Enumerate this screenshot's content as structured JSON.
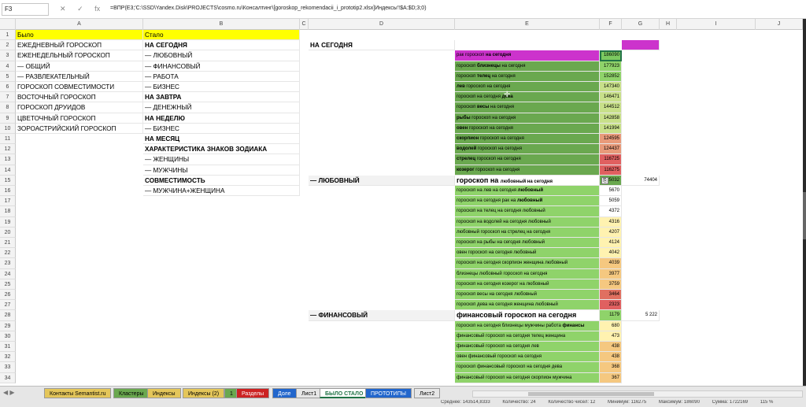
{
  "formula_bar": {
    "name_box": "F3",
    "fx": "fx",
    "formula": "=ВПР(E3;'C:\\SSD\\Yandex.Disk\\PROJECTS\\cosmo.ru\\Консалтинг\\[goroskop_rekomendacii_i_prototip2.xlsx]Индексы'!$A:$D;3;0)"
  },
  "columns": [
    "A",
    "B",
    "C",
    "D",
    "E",
    "F",
    "G",
    "H",
    "I",
    "J"
  ],
  "rows": [
    "1",
    "2",
    "3",
    "4",
    "5",
    "6",
    "7",
    "8",
    "9",
    "10",
    "11",
    "12",
    "13",
    "14",
    "15",
    "16",
    "17",
    "18",
    "19",
    "20",
    "21",
    "22",
    "23",
    "24",
    "25",
    "26",
    "27",
    "28",
    "29",
    "30",
    "31",
    "32",
    "33",
    "34"
  ],
  "col_a": [
    "Было",
    "ЕЖЕДНЕВНЫЙ ГОРОСКОП",
    "ЕЖЕНЕДЕЛЬНЫЙ ГОРОСКОП",
    "— ОБЩИЙ",
    "— РАЗВЛЕКАТЕЛЬНЫЙ",
    "ГОРОСКОП СОВМЕСТИМОСТИ",
    "ВОСТОЧНЫЙ ГОРОСКОП",
    "ГОРОСКОП ДРУИДОВ",
    "ЦВЕТОЧНЫЙ ГОРОСКОП",
    "ЗОРОАСТРИЙСКИЙ ГОРОСКОП"
  ],
  "col_b": [
    "Стало",
    "НА СЕГОДНЯ",
    "— ЛЮБОВНЫЙ",
    "— ФИНАНСОВЫЙ",
    "— РАБОТА",
    "— БИЗНЕС",
    "НА ЗАВТРА",
    "— ДЕНЕЖНЫЙ",
    "НА НЕДЕЛЮ",
    "— БИЗНЕС",
    "НА МЕСЯЦ",
    "ХАРАКТЕРИСТИКА ЗНАКОВ ЗОДИАКА",
    "— ЖЕНЩИНЫ",
    "— МУЖЧИНЫ",
    "СОВМЕСТИМОСТЬ",
    "— МУЖЧИНА+ЖЕНЩИНА"
  ],
  "col_d": {
    "r2": "НА СЕГОДНЯ",
    "r15": "— ЛЮБОВНЫЙ",
    "r28": "— ФИНАНСОВЫЙ"
  },
  "col_e": [
    {
      "pre": "рак гороскоп ",
      "bold": "на сегодня",
      "post": ""
    },
    {
      "pre": "гороскоп ",
      "bold": "близнецы",
      "post": " на сегодня"
    },
    {
      "pre": "гороскоп ",
      "bold": "телец",
      "post": " на сегодня"
    },
    {
      "pre": "",
      "bold": "лев",
      "post": " гороскоп на сегодня"
    },
    {
      "pre": "гороскоп на сегодня ",
      "bold": "дева",
      "post": ""
    },
    {
      "pre": "гороскоп ",
      "bold": "весы",
      "post": " на сегодня"
    },
    {
      "pre": "",
      "bold": "рыбы",
      "post": " гороскоп на сегодня"
    },
    {
      "pre": "",
      "bold": "овен",
      "post": " гороскоп на сегодня"
    },
    {
      "pre": "",
      "bold": "скорпион",
      "post": " гороскоп на сегодня"
    },
    {
      "pre": "",
      "bold": "водолей",
      "post": " гороскоп на сегодня"
    },
    {
      "pre": "",
      "bold": "стрелец",
      "post": " гороскоп на сегодня"
    },
    {
      "pre": "",
      "bold": "козерог",
      "post": " гороскоп на сегодня"
    },
    {
      "pre": "гороскоп на ",
      "bold": "любовный",
      "post": " на сегодня",
      "big": "гороскоп на "
    },
    {
      "pre": "гороскоп на лев на сегодня ",
      "bold": "любовный",
      "post": ""
    },
    {
      "pre": "гороскоп на сегодня рак на ",
      "bold": "любовный",
      "post": ""
    },
    {
      "pre": "гороскоп на телец на сегодня любовный",
      "bold": "",
      "post": ""
    },
    {
      "pre": "гороскоп на водолей на сегодня любовный",
      "bold": "",
      "post": ""
    },
    {
      "pre": "любовный гороскоп на стрелец на сегодня",
      "bold": "",
      "post": ""
    },
    {
      "pre": "гороскоп на рыбы на сегодня любовный",
      "bold": "",
      "post": ""
    },
    {
      "pre": "овен гороскоп на сегодня любовный",
      "bold": "",
      "post": ""
    },
    {
      "pre": "гороскоп на сегодня скорпион женщина любовный",
      "bold": "",
      "post": ""
    },
    {
      "pre": "близнецы любовный гороскоп на сегодня",
      "bold": "",
      "post": ""
    },
    {
      "pre": "гороскоп на сегодня козерог на любовный",
      "bold": "",
      "post": ""
    },
    {
      "pre": "гороскоп весы на сегодня любовный",
      "bold": "",
      "post": ""
    },
    {
      "pre": "гороскоп дева на сегодня женщина любовный",
      "bold": "",
      "post": ""
    },
    {
      "pre": "финансовый гороскоп на сегодня",
      "bold": "",
      "post": "",
      "big": "финансовый гороскоп на сегодня"
    },
    {
      "pre": "гороскоп на сегодня близнецы мужчины работа ",
      "bold": "финансы",
      "post": ""
    },
    {
      "pre": "финансовый гороскоп на сегодня телец женщина",
      "bold": "",
      "post": ""
    },
    {
      "pre": "финансовый гороскоп на сегодня лев",
      "bold": "",
      "post": ""
    },
    {
      "pre": "овен финансовый гороскоп на сегодня",
      "bold": "",
      "post": ""
    },
    {
      "pre": "гороскоп финансовый гороскоп на сегодня дева",
      "bold": "",
      "post": ""
    },
    {
      "pre": "финансовый гороскоп на сегодня скорпион мужчина",
      "bold": "",
      "post": ""
    }
  ],
  "col_f": [
    "186090",
    "177923",
    "152852",
    "147340",
    "146471",
    "144512",
    "142858",
    "141994",
    "124595",
    "124437",
    "116725",
    "116275",
    "25032",
    "5670",
    "5059",
    "4372",
    "4316",
    "4207",
    "4124",
    "4042",
    "4039",
    "3977",
    "3759",
    "3464",
    "2323",
    "1179",
    "680",
    "473",
    "438",
    "438",
    "368",
    "367"
  ],
  "col_g": {
    "r15": "74404",
    "r28": "5 222"
  },
  "colors": {
    "header_yellow": "#ffff00",
    "magenta": "#cc33cc",
    "dark_green": "#6aa84f",
    "light_green": "#8fd36a",
    "red_low": "#e06060",
    "orange_low": "#f0b060",
    "selection_outline": "#217346"
  },
  "tabs": [
    {
      "label": "Контакты Semantist.ru",
      "color": "#e4c65a",
      "text_color": "#000"
    },
    {
      "label": "Кластеры",
      "color": "#6aa84f",
      "text_color": "#000"
    },
    {
      "label": "Индексы",
      "color": "#e4c65a",
      "text_color": "#000"
    },
    {
      "label": "Индексы (2)",
      "color": "#e4c65a",
      "text_color": "#000"
    },
    {
      "label": "1",
      "color": "#6aa84f",
      "text_color": "#000"
    },
    {
      "label": "Разделы",
      "color": "#cc2222",
      "text_color": "#fff"
    },
    {
      "label": "Доле",
      "color": "#2266cc",
      "text_color": "#fff"
    },
    {
      "label": "Лист1",
      "color": "#e6e6e6",
      "text_color": "#000"
    },
    {
      "label": "БЫЛО СТАЛО",
      "color": "#ffffff",
      "text_color": "#217346"
    },
    {
      "label": "ПРОТОТИПЫ",
      "color": "#2266cc",
      "text_color": "#fff"
    },
    {
      "label": "Лист2",
      "color": "#e6e6e6",
      "text_color": "#000"
    }
  ],
  "status": {
    "average": "Среднее: 143514,8333",
    "count": "Количество: 24",
    "numcount": "Количество чисел: 12",
    "min": "Минимум: 116275",
    "max": "Максимум: 186090",
    "sum": "Сумма: 1722169",
    "zoom": "115 %"
  }
}
